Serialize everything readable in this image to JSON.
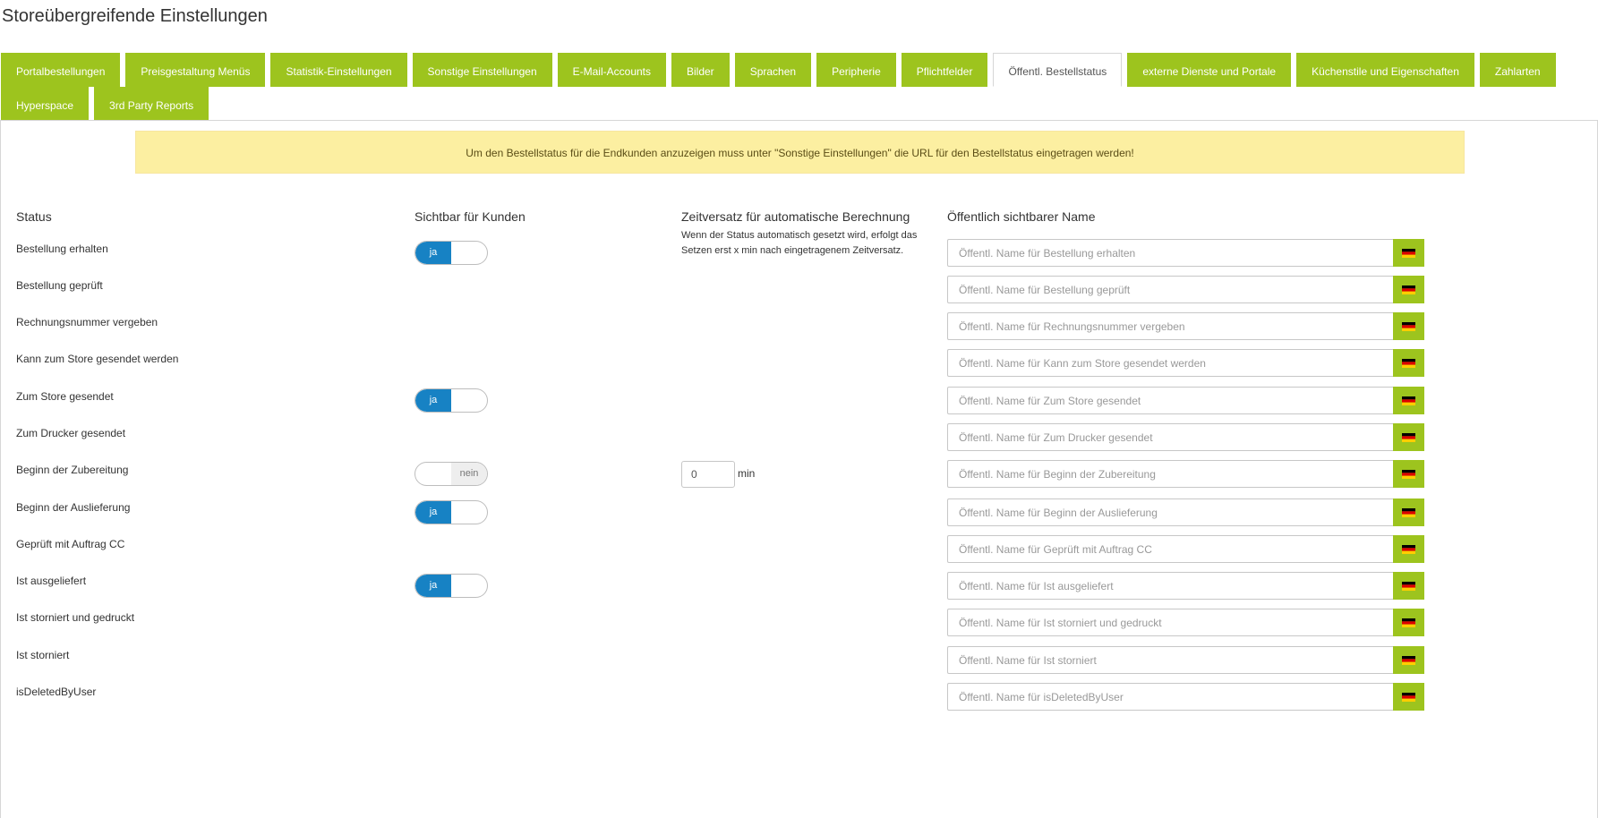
{
  "page": {
    "title": "Storeübergreifende Einstellungen"
  },
  "tabs": [
    {
      "label": "Portalbestellungen",
      "active": false
    },
    {
      "label": "Preisgestaltung Menüs",
      "active": false
    },
    {
      "label": "Statistik-Einstellungen",
      "active": false
    },
    {
      "label": "Sonstige Einstellungen",
      "active": false
    },
    {
      "label": "E-Mail-Accounts",
      "active": false
    },
    {
      "label": "Bilder",
      "active": false
    },
    {
      "label": "Sprachen",
      "active": false
    },
    {
      "label": "Peripherie",
      "active": false
    },
    {
      "label": "Pflichtfelder",
      "active": false
    },
    {
      "label": "Öffentl. Bestellstatus",
      "active": true
    },
    {
      "label": "externe Dienste und Portale",
      "active": false
    },
    {
      "label": "Küchenstile und Eigenschaften",
      "active": false
    },
    {
      "label": "Zahlarten",
      "active": false
    },
    {
      "label": "Hyperspace",
      "active": false
    },
    {
      "label": "3rd Party Reports",
      "active": false
    }
  ],
  "notice": "Um den Bestellstatus für die Endkunden anzuzeigen muss unter \"Sonstige Einstellungen\" die URL für den Bestellstatus eingetragen werden!",
  "columns": {
    "status": "Status",
    "visible": "Sichtbar für Kunden",
    "offset": "Zeitversatz für automatische Berechnung",
    "offset_hint": "Wenn der Status automatisch gesetzt wird, erfolgt das Setzen erst x min nach eingetragenem Zeitversatz.",
    "public_name": "Öffentlich sichtbarer Name"
  },
  "toggle_labels": {
    "on": "ja",
    "off": "nein"
  },
  "minutes_unit": "min",
  "colors": {
    "accent_green": "#9dc41e",
    "toggle_blue": "#1782c4",
    "notice_bg": "#fcefa1"
  },
  "rows": [
    {
      "label": "Bestellung erhalten",
      "toggle": "ja",
      "placeholder": "Öffentl. Name für Bestellung erhalten"
    },
    {
      "label": "Bestellung geprüft",
      "toggle": null,
      "placeholder": "Öffentl. Name für Bestellung geprüft"
    },
    {
      "label": "Rechnungsnummer vergeben",
      "toggle": null,
      "placeholder": "Öffentl. Name für Rechnungsnummer vergeben"
    },
    {
      "label": "Kann zum Store gesendet werden",
      "toggle": null,
      "placeholder": "Öffentl. Name für Kann zum Store gesendet werden"
    },
    {
      "label": "Zum Store gesendet",
      "toggle": "ja",
      "placeholder": "Öffentl. Name für Zum Store gesendet"
    },
    {
      "label": "Zum Drucker gesendet",
      "toggle": null,
      "placeholder": "Öffentl. Name für Zum Drucker gesendet"
    },
    {
      "label": "Beginn der Zubereitung",
      "toggle": "nein",
      "minutes": "0",
      "placeholder": "Öffentl. Name für Beginn der Zubereitung"
    },
    {
      "label": "Beginn der Auslieferung",
      "toggle": "ja",
      "placeholder": "Öffentl. Name für Beginn der Auslieferung"
    },
    {
      "label": "Geprüft mit Auftrag CC",
      "toggle": null,
      "placeholder": "Öffentl. Name für Geprüft mit Auftrag CC"
    },
    {
      "label": "Ist ausgeliefert",
      "toggle": "ja",
      "placeholder": "Öffentl. Name für Ist ausgeliefert"
    },
    {
      "label": "Ist storniert und gedruckt",
      "toggle": null,
      "placeholder": "Öffentl. Name für Ist storniert und gedruckt"
    },
    {
      "label": "Ist storniert",
      "toggle": null,
      "placeholder": "Öffentl. Name für Ist storniert"
    },
    {
      "label": "isDeletedByUser",
      "toggle": null,
      "placeholder": "Öffentl. Name für isDeletedByUser"
    }
  ]
}
